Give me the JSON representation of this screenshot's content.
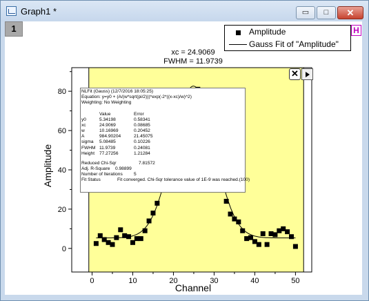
{
  "window": {
    "title": "Graph1 *",
    "layer_label": "1",
    "minimize": "▭",
    "maximize": "□",
    "close": "✕"
  },
  "annotation": {
    "xc_line": "xc = 24.9069",
    "fwhm_line": "FWHM = 11.9739"
  },
  "legend": {
    "entries": [
      "Amplitude",
      "Gauss Fit of \"Amplitude\""
    ],
    "badge": "H"
  },
  "fit_report": {
    "header": "NLFit (Gauss) (12/7/2016 18:05:25)",
    "equation": "Equation: y=y0 + (A/(w*sqrt(pi/2)))*exp(-2*((x-xc)/w)^2)",
    "weighting": "Weighting: No Weighting",
    "col_value": "Value",
    "col_error": "Error",
    "params": [
      {
        "name": "y0",
        "value": "5.34198",
        "error": "0.58341"
      },
      {
        "name": "xc",
        "value": "24.9069",
        "error": "0.08685"
      },
      {
        "name": "w",
        "value": "10.16969",
        "error": "0.20452"
      },
      {
        "name": "A",
        "value": "984.90204",
        "error": "21.45075"
      },
      {
        "name": "sigma",
        "value": "5.08485",
        "error": "0.10226"
      },
      {
        "name": "FWHM",
        "value": "11.9739",
        "error": "0.24081"
      },
      {
        "name": "Height",
        "value": "77.27256",
        "error": "1.21284"
      }
    ],
    "reduced_chisqr_label": "Reduced Chi-Sqr",
    "reduced_chisqr": "7.81572",
    "adj_r2_label": "Adj. R-Square",
    "adj_r2": "0.98899",
    "iterations_label": "Number of Iterations",
    "iterations": "5",
    "status_label": "Fit Status",
    "status": "Fit converged. Chi-Sqr tolerance value of 1E-9 was reached.(100)",
    "close_button": "✕"
  },
  "colors": {
    "plot_bg": "#ffff99",
    "window_frame": "#c9d9ec",
    "badge": "#c000c0"
  },
  "chart_data": {
    "type": "scatter",
    "xlabel": "Channel",
    "ylabel": "Amplitude",
    "xlim": [
      -5,
      54
    ],
    "ylim": [
      -12,
      92
    ],
    "xticks": [
      0,
      10,
      20,
      30,
      40,
      50
    ],
    "yticks": [
      0,
      20,
      40,
      60,
      80
    ],
    "fit_params": {
      "y0": 5.34198,
      "xc": 24.9069,
      "w": 10.16969,
      "A": 984.90204
    },
    "series": [
      {
        "name": "Amplitude",
        "x": [
          1,
          2,
          3,
          4,
          5,
          6,
          7,
          8,
          9,
          10,
          11,
          12,
          13,
          14,
          15,
          16,
          25,
          26,
          33,
          34,
          35,
          36,
          37,
          38,
          39,
          40,
          41,
          42,
          43,
          44,
          45,
          46,
          47,
          48,
          49,
          50
        ],
        "y": [
          2.5,
          6.5,
          4.5,
          3,
          2,
          5.5,
          9.5,
          6.5,
          6,
          3,
          5,
          5,
          9,
          14,
          18,
          23,
          79,
          81,
          24,
          17.5,
          15,
          13.5,
          9,
          5,
          5.5,
          3.5,
          2,
          7.5,
          2,
          7.5,
          7,
          9,
          10,
          8.5,
          6,
          1
        ]
      },
      {
        "name": "Gauss Fit of \"Amplitude\"",
        "kind": "line"
      }
    ]
  }
}
